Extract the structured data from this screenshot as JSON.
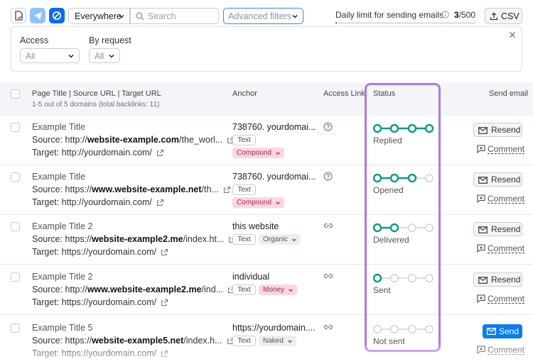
{
  "toolbar": {
    "location_select": "Everywhere",
    "search_placeholder": "Search",
    "advanced_filters": "Advanced filters",
    "daily_limit_label": "Daily limit for sending emails",
    "limit_used": "3",
    "limit_total": "/500",
    "limit_fraction": 0.006,
    "csv_label": "CSV"
  },
  "filters": {
    "access_label": "Access",
    "access_value": "All",
    "by_request_label": "By request",
    "by_request_value": "All"
  },
  "table": {
    "col_page": "Page Title | Source URL | Target URL",
    "col_page_sub": "1-5 out of 5 domains (total backlinks: 11)",
    "col_anchor": "Anchor",
    "col_access": "Access Link",
    "col_status": "Status",
    "col_send": "Send email",
    "rows": [
      {
        "title": "Example Title",
        "src_prefix": "Source: http://",
        "src_bold": "website-example.com",
        "src_rest": "/the_worl...",
        "target": "Target: http://yourdomain.com/",
        "anchor": "738760. yourdomai...",
        "type": "Text",
        "tag": "Compound",
        "status": "Replied",
        "filled": 4,
        "action": "Resend",
        "comment": "Comment"
      },
      {
        "title": "Example Title",
        "src_prefix": "Source: https://",
        "src_bold": "www.website-example.net",
        "src_rest": "/th...",
        "target": "Target: http://yourdomain.com/",
        "anchor": "738760. yourdomai...",
        "type": "Text",
        "tag": "Compound",
        "status": "Opened",
        "filled": 3,
        "action": "Resend",
        "comment": "Comment"
      },
      {
        "title": "Example Title 2",
        "src_prefix": "Source: https://",
        "src_bold": "website-example2.me",
        "src_rest": "/index.ht...",
        "target": "Target: https://yourdomain.com/",
        "anchor": "this website",
        "type": "Text",
        "tag": "Organic",
        "status": "Delivered",
        "filled": 2,
        "action": "Resend",
        "comment": "Comment"
      },
      {
        "title": "Example Title 2",
        "src_prefix": "Source: http://",
        "src_bold": "www.website-example2.me",
        "src_rest": "/ind...",
        "target": "Target: https://yourdomain.com/",
        "anchor": "individual",
        "type": "Text",
        "tag": "Money",
        "status": "Sent",
        "filled": 1,
        "action": "Resend",
        "comment": "Comment"
      },
      {
        "title": "Example Title 5",
        "src_prefix": "Source: https://",
        "src_bold": "website-example5.net",
        "src_rest": "/index.h...",
        "target": "Target: https://yourdomain.com/",
        "anchor": "https://yourdomain....",
        "type": "Text",
        "tag": "Naked",
        "status": "Not sent",
        "filled": 0,
        "action": "Send",
        "comment": "Comment"
      }
    ]
  },
  "colors": {
    "step_green": "#0e9f7e",
    "step_gray": "#c3c7cd",
    "highlight": "#b077e6",
    "send_blue": "#0a7cf0"
  },
  "icons": {
    "access_icons": [
      "help-circle-icon",
      "help-circle-icon",
      "link-icon",
      "link-icon",
      "link-icon"
    ]
  }
}
